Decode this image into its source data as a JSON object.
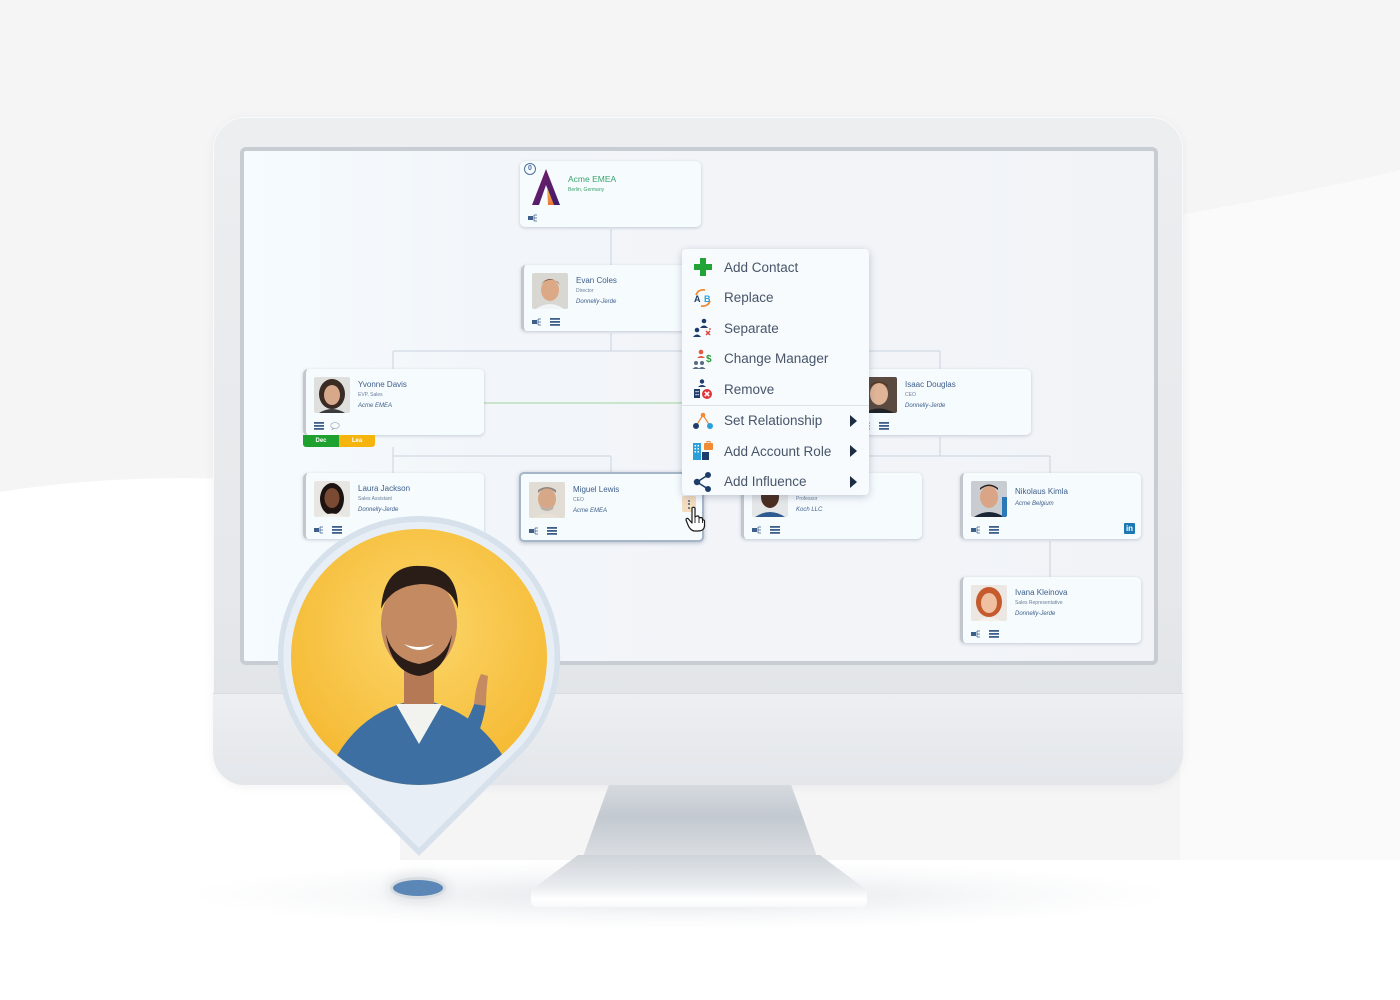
{
  "org_chart": {
    "root": {
      "name": "Acme EMEA",
      "location": "Berlin, Germany",
      "badge_count": "0"
    },
    "nodes": [
      {
        "id": "evan",
        "name": "Evan Coles",
        "title": "Director",
        "company": "Donnelly-Jerde",
        "icons": [
          "influence-icon",
          "list-icon"
        ]
      },
      {
        "id": "yvonne",
        "name": "Yvonne Davis",
        "title": "EVP, Sales",
        "company": "Acme EMEA",
        "icons": [
          "list-icon",
          "comment-icon"
        ],
        "tags": [
          "Dec",
          "Lea"
        ]
      },
      {
        "id": "isaac",
        "name": "Isaac Douglas",
        "title": "CEO",
        "company": "Donnelly-Jerde",
        "icons": [
          "influence-icon",
          "list-icon"
        ]
      },
      {
        "id": "laura",
        "name": "Laura Jackson",
        "title": "Sales Assistant",
        "company": "Donnelly-Jerde",
        "icons": [
          "influence-icon",
          "list-icon"
        ]
      },
      {
        "id": "miguel",
        "name": "Miguel Lewis",
        "title": "CEO",
        "company": "Acme EMEA",
        "icons": [
          "influence-icon",
          "list-icon"
        ],
        "selected": true
      },
      {
        "id": "professor",
        "name": "",
        "title": "Professor",
        "company": "Koch LLC",
        "icons": [
          "influence-icon",
          "list-icon"
        ]
      },
      {
        "id": "nikolaus",
        "name": "Nikolaus Kimla",
        "title": "",
        "company": "Acme Belgium",
        "icons": [
          "influence-icon",
          "list-icon"
        ],
        "linkedin": "in"
      },
      {
        "id": "ivana",
        "name": "Ivana Kleinova",
        "title": "Sales Representative",
        "company": "Donnelly-Jerde",
        "icons": [
          "influence-icon",
          "list-icon"
        ]
      }
    ]
  },
  "context_menu": {
    "items": [
      {
        "label": "Add Contact",
        "icon": "add-contact-plus-icon",
        "submenu": false
      },
      {
        "label": "Replace",
        "icon": "replace-ab-icon",
        "submenu": false
      },
      {
        "label": "Separate",
        "icon": "separate-icon",
        "submenu": false
      },
      {
        "label": "Change Manager",
        "icon": "change-manager-icon",
        "submenu": false
      },
      {
        "label": "Remove",
        "icon": "remove-icon",
        "submenu": false
      },
      {
        "label": "Set Relationship",
        "icon": "relationship-icon",
        "submenu": true
      },
      {
        "label": "Add Account Role",
        "icon": "account-role-icon",
        "submenu": true
      },
      {
        "label": "Add Influence",
        "icon": "share-influence-icon",
        "submenu": true
      }
    ]
  },
  "colors": {
    "root_text": "#3aa36b",
    "node_text": "#3e5f8a",
    "tag_dec": "#1ea12e",
    "tag_lea": "#f5b50e",
    "relationship_line": "#9fd39a",
    "tree_line": "#c9d3de",
    "linkedin": "#1b78b5",
    "pin_background": "#f7c33d"
  }
}
